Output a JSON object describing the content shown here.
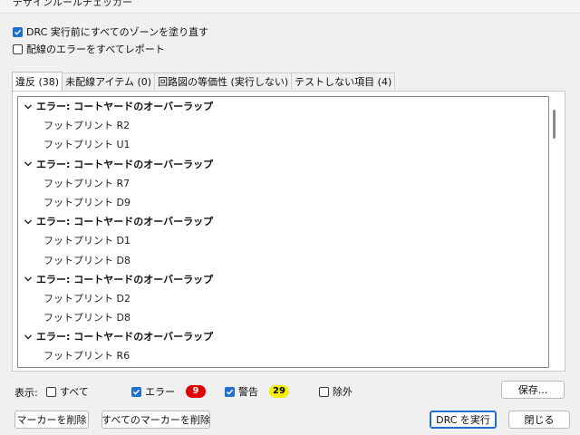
{
  "window": {
    "title": "デザインルールチェッカー"
  },
  "options": {
    "refill_zones": {
      "label": "DRC 実行前にすべてのゾーンを塗り直す",
      "checked": true
    },
    "report_all_track_errors": {
      "label": "配線のエラーをすべてレポート",
      "checked": false
    }
  },
  "tabs": [
    {
      "label": "違反 (38)",
      "active": true
    },
    {
      "label": "未配線アイテム (0)",
      "active": false
    },
    {
      "label": "回路図の等価性 (実行しない)",
      "active": false
    },
    {
      "label": "テストしない項目 (4)",
      "active": false
    }
  ],
  "violations": [
    {
      "title": "エラー: コートヤードのオーバーラップ",
      "items": [
        "フットプリント R2",
        "フットプリント U1"
      ]
    },
    {
      "title": "エラー: コートヤードのオーバーラップ",
      "items": [
        "フットプリント R7",
        "フットプリント D9"
      ]
    },
    {
      "title": "エラー: コートヤードのオーバーラップ",
      "items": [
        "フットプリント D1",
        "フットプリント D8"
      ]
    },
    {
      "title": "エラー: コートヤードのオーバーラップ",
      "items": [
        "フットプリント D2",
        "フットプリント D8"
      ]
    },
    {
      "title": "エラー: コートヤードのオーバーラップ",
      "items": [
        "フットプリント R6"
      ]
    }
  ],
  "filters": {
    "show_label": "表示:",
    "all": {
      "label": "すべて",
      "checked": false
    },
    "errors": {
      "label": "エラー",
      "checked": true,
      "count": "9"
    },
    "warnings": {
      "label": "警告",
      "checked": true,
      "count": "29"
    },
    "exclusions": {
      "label": "除外",
      "checked": false
    }
  },
  "buttons": {
    "save": "保存...",
    "delete_marker": "マーカーを削除",
    "delete_all_markers": "すべてのマーカーを削除",
    "run_drc": "DRC を実行",
    "close": "閉じる"
  }
}
